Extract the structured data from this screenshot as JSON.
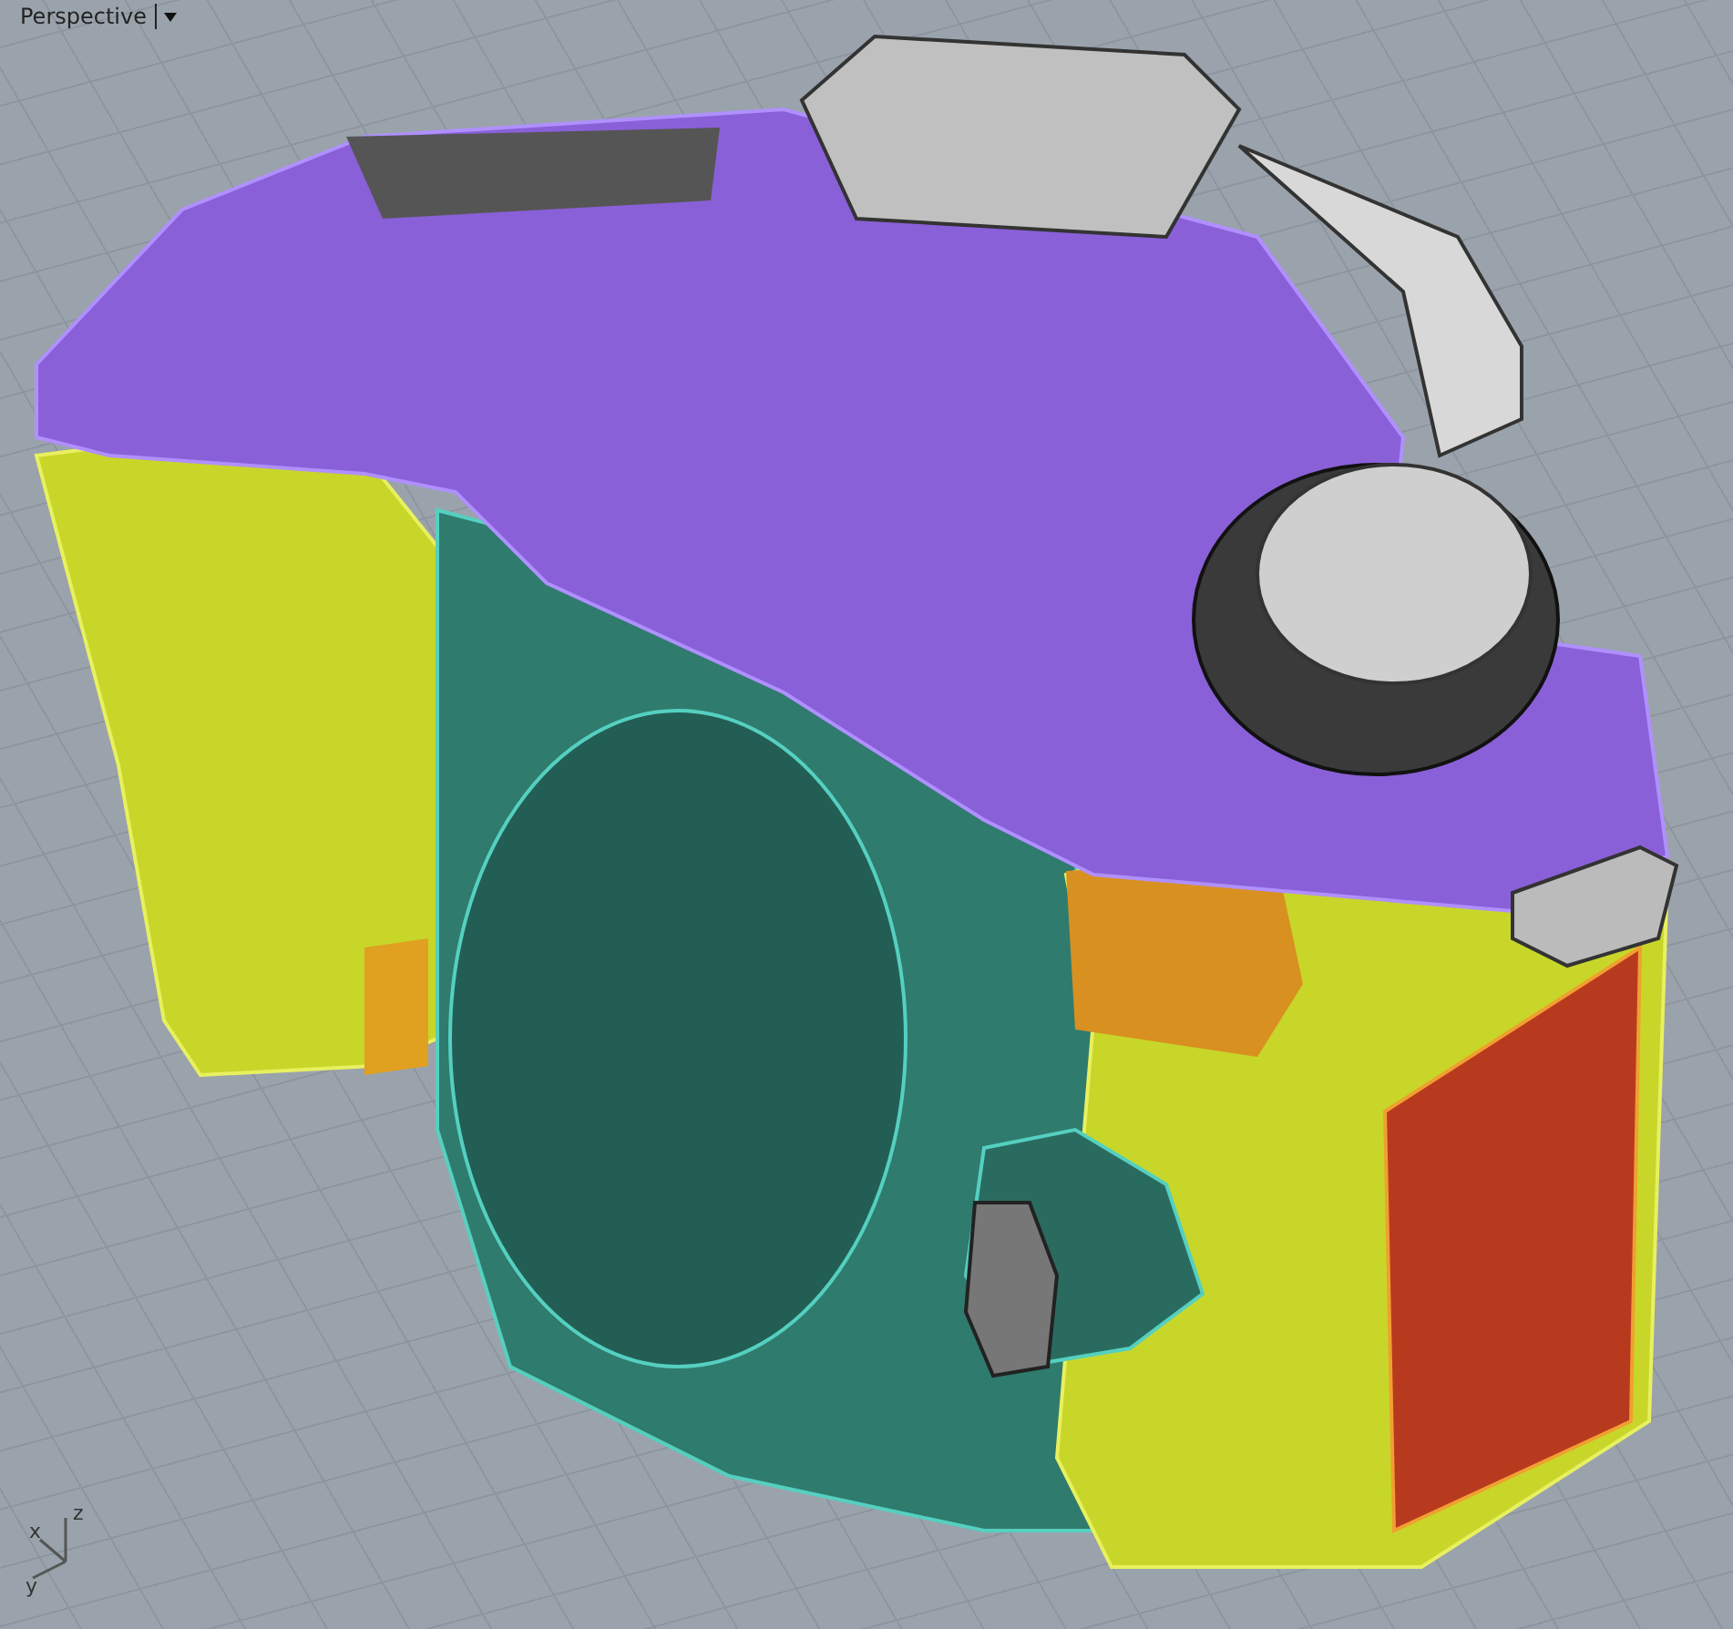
{
  "viewport": {
    "title": "Perspective"
  },
  "axes": {
    "labels": [
      "z",
      "x",
      "y"
    ]
  }
}
